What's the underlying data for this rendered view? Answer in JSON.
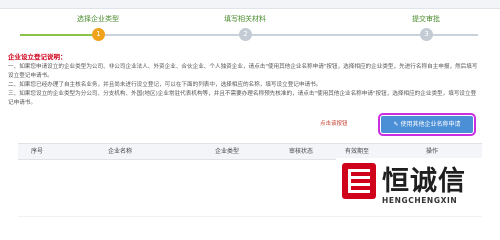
{
  "topbar": {
    "items": [
      "",
      "",
      "",
      "",
      "",
      "",
      "",
      ""
    ]
  },
  "steps": [
    {
      "label": "选择企业类型",
      "number": "1",
      "state": "active"
    },
    {
      "label": "填写相关材料",
      "number": "2",
      "state": "pending"
    },
    {
      "label": "提交审批",
      "number": "3",
      "state": "pending"
    }
  ],
  "instructions": {
    "title": "企业设立登记说明：",
    "lines": [
      "一、如果您申请设立的企业类型为公司、非公司企业法人、外资企业、合伙企业、个人独资企业，请点击\"使用其他企业名称申请\"按钮，选择相应的企业类型，先进行名称自主申报，然后填写设立登记申请书。",
      "二、如果您已经办理了自主核名业务，并且尚未进行设立登记，可以在下面的列表中，选择相应的名称，填写设立登记申请书。",
      "三、如果您设立的企业类型为分公司、分支机构、外国(地区)企业常驻代表机构等，并且不需要办理名称预先核准的，请点击\"使用其他企业名称申请\"按钮，选择相应的企业类型，填写设立登记申请书。"
    ]
  },
  "annotation": "点击该按钮",
  "apply_button": {
    "label": "使用其他企业名称申请",
    "icon": "edit-icon"
  },
  "table": {
    "columns": [
      "序号",
      "企业名称",
      "企业类型",
      "审核状态",
      "有效期至",
      "操作"
    ]
  },
  "watermark": {
    "text": "恒诚信",
    "sub": "HENGCHENGXIN",
    "color": "#d0021b"
  },
  "colors": {
    "accent_green": "#8bc34a",
    "step_active": "#f0a31a",
    "button_blue": "#4b8fd6",
    "annotation_red": "#c0392b"
  }
}
